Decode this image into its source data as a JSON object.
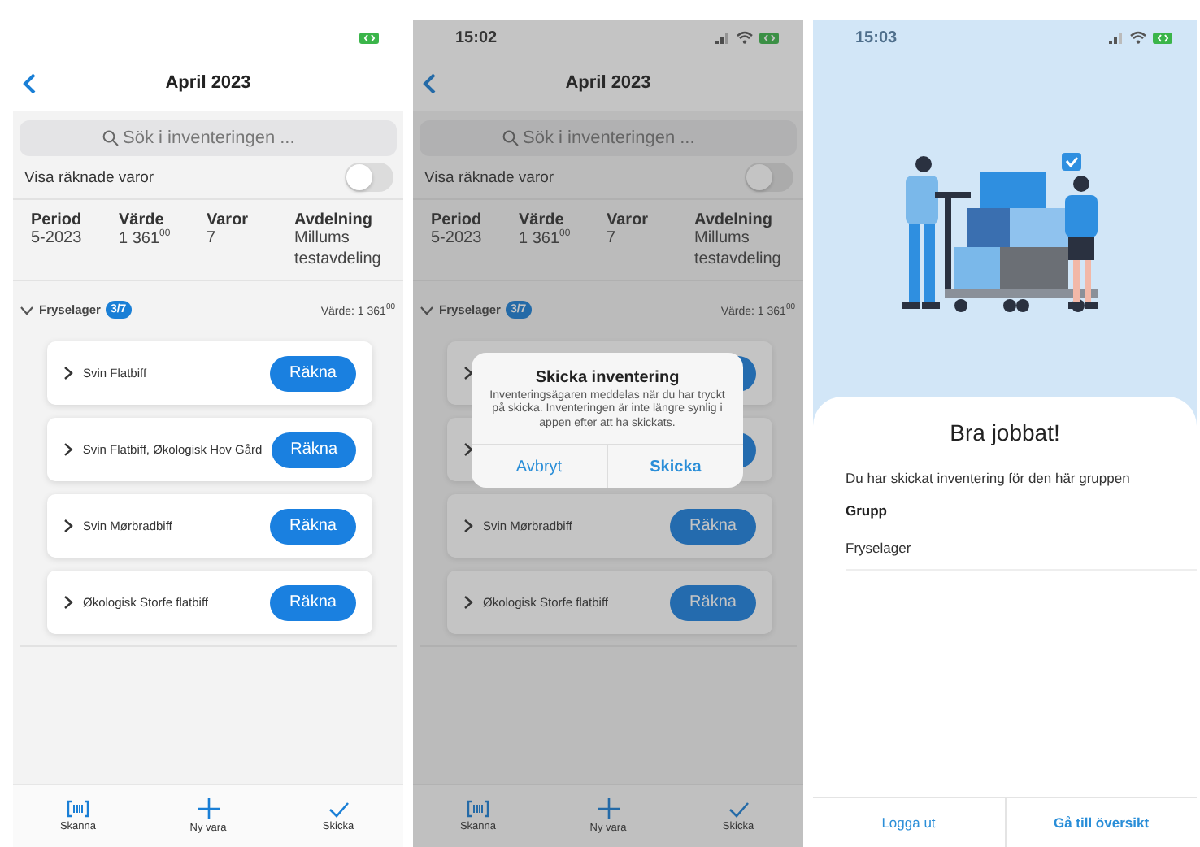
{
  "screens": [
    {
      "kind": "inventory",
      "title": "April 2023",
      "search": {
        "placeholder": "Sök i inventeringen ..."
      },
      "toggle": {
        "label": "Visa räknade varor",
        "on": false
      },
      "stats": [
        {
          "label": "Period",
          "value": "5-2023"
        },
        {
          "label": "Värde",
          "value": "1 361$^{00}$"
        },
        {
          "label": "Varor",
          "value": "7"
        },
        {
          "label": "Avdelning",
          "value": "Millums testavdeling"
        }
      ],
      "group": {
        "name": "Fryselager",
        "badge": "3/7",
        "value": "Värde: 1 361$^{00}$",
        "expanded": true
      },
      "items": [
        {
          "name": "Svin Flatbiff",
          "button": "Räkna",
          "expanded": false
        },
        {
          "name": "Svin Flatbiff, Økologisk Hov Gård",
          "button": "Räkna",
          "expanded": false
        },
        {
          "name": "Svin Mørbradbiff",
          "button": "Räkna",
          "expanded": false
        },
        {
          "name": "Økologisk Storfe flatbiff",
          "button": "Räkna",
          "expanded": false
        }
      ],
      "bottom_nav": [
        {
          "kind": "scan",
          "label": "Skanna"
        },
        {
          "kind": "add",
          "label": "Ny vara"
        },
        {
          "kind": "send",
          "label": "Skicka"
        }
      ]
    },
    {
      "kind": "inventory",
      "status_bar": {
        "time": "15:02"
      },
      "title": "April 2023",
      "search": {
        "placeholder": "Sök i inventeringen ..."
      },
      "toggle": {
        "label": "Visa räknade varor",
        "on": false
      },
      "stats": [
        {
          "label": "Period",
          "value": "5-2023"
        },
        {
          "label": "Värde",
          "value": "1 361$^{00}$"
        },
        {
          "label": "Varor",
          "value": "7"
        },
        {
          "label": "Avdelning",
          "value": "Millums testavdeling"
        }
      ],
      "group": {
        "name": "Fryselager",
        "badge": "3/7",
        "value": "Värde: 1 361$^{00}$",
        "expanded": true
      },
      "items": [
        {
          "expanded": false
        },
        {
          "expanded": false
        },
        {
          "name": "Svin Mørbradbiff",
          "button": "Räkna",
          "expanded": false
        },
        {
          "name": "Økologisk Storfe flatbiff",
          "button": "Räkna",
          "expanded": false
        }
      ],
      "bottom_nav": [
        {
          "kind": "scan",
          "label": "Skanna"
        },
        {
          "kind": "add",
          "label": "Ny vara"
        },
        {
          "kind": "send",
          "label": "Skicka"
        }
      ],
      "dialog": {
        "title": "Skicka inventering",
        "message": "Inventeringsägaren meddelas när du har tryckt på skicka. Inventeringen är inte längre synlig i appen efter att ha skickats.",
        "cancel": "Avbryt",
        "confirm": "Skicka"
      }
    },
    {
      "kind": "success",
      "status_bar": {
        "time": "15:03"
      },
      "heading": "Bra jobbat!",
      "message": "Du har skickat inventering för den här gruppen",
      "group_label": "Grupp",
      "group_value": "Fryselager",
      "buttons": [
        {
          "kind": "plain",
          "label": "Logga ut"
        },
        {
          "kind": "primary",
          "label": "Gå till översikt"
        }
      ]
    }
  ]
}
